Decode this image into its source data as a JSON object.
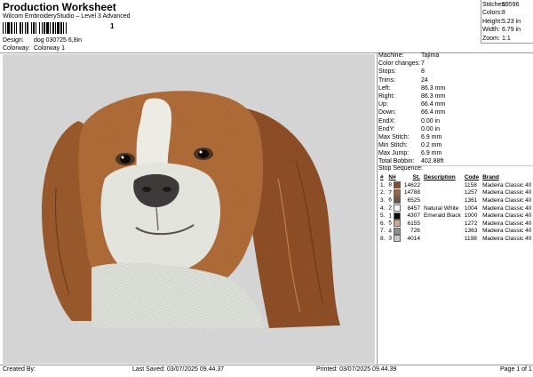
{
  "header": {
    "title": "Production Worksheet",
    "subtitle": "Wilcom EmbroideryStudio – Level 3 Advanced",
    "barcode_suffix": "1"
  },
  "design_info": [
    {
      "label": "Design:",
      "value": "dog 030725 6,8in"
    },
    {
      "label": "Colorway:",
      "value": "Colorway 1"
    }
  ],
  "stats": [
    {
      "label": "Stitches:",
      "value": "59596"
    },
    {
      "label": "Colors:",
      "value": "8"
    },
    {
      "label": "Height:",
      "value": "5.23 in"
    },
    {
      "label": "Width:",
      "value": "6.79 in"
    },
    {
      "label": "Zoom:",
      "value": "1:1"
    }
  ],
  "machine_info": [
    {
      "label": "Machine:",
      "value": "Tajima"
    },
    {
      "label": "Color changes:",
      "value": "7"
    },
    {
      "label": "Stops:",
      "value": "8"
    },
    {
      "label": "Trims:",
      "value": "24"
    },
    {
      "label": "Left:",
      "value": "86.3 mm"
    },
    {
      "label": "Right:",
      "value": "86.3 mm"
    },
    {
      "label": "Up:",
      "value": "66.4 mm"
    },
    {
      "label": "Down:",
      "value": "66.4 mm"
    },
    {
      "label": "EndX:",
      "value": "0.00 in"
    },
    {
      "label": "EndY:",
      "value": "0.00 in"
    },
    {
      "label": "Max Stitch:",
      "value": "6.9 mm"
    },
    {
      "label": "Min Stitch:",
      "value": "0.2 mm"
    },
    {
      "label": "Max Jump:",
      "value": "6.9 mm"
    },
    {
      "label": "Total Bobbin:",
      "value": "402.88ft"
    }
  ],
  "stop_sequence": {
    "title": "Stop Sequence:",
    "headers": [
      "#",
      "N#",
      "St.",
      "Description",
      "Code",
      "Brand"
    ],
    "rows": [
      {
        "num": "1.",
        "n": "8",
        "color": "#8c4a28",
        "st": "14622",
        "desc": "",
        "code": "1158",
        "brand": "Madeira Classic 40"
      },
      {
        "num": "2.",
        "n": "7",
        "color": "#a0623a",
        "st": "14788",
        "desc": "",
        "code": "1257",
        "brand": "Madeira Classic 40"
      },
      {
        "num": "3.",
        "n": "6",
        "color": "#6e5648",
        "st": "6525",
        "desc": "",
        "code": "1361",
        "brand": "Madeira Classic 40"
      },
      {
        "num": "4.",
        "n": "2",
        "color": "#f4f4f4",
        "st": "8457",
        "desc": "Natural White",
        "code": "1004",
        "brand": "Madeira Classic 40"
      },
      {
        "num": "5.",
        "n": "1",
        "color": "#0a0a0a",
        "st": "4307",
        "desc": "Emerald Black",
        "code": "1000",
        "brand": "Madeira Classic 40"
      },
      {
        "num": "6.",
        "n": "5",
        "color": "#d6a48c",
        "st": "6155",
        "desc": "",
        "code": "1272",
        "brand": "Madeira Classic 40"
      },
      {
        "num": "7.",
        "n": "4",
        "color": "#8f8f8a",
        "st": "726",
        "desc": "",
        "code": "1363",
        "brand": "Madeira Classic 40"
      },
      {
        "num": "8.",
        "n": "3",
        "color": "#c6c8c6",
        "st": "4014",
        "desc": "",
        "code": "1198",
        "brand": "Madeira Classic 40"
      }
    ]
  },
  "footer": {
    "created_by": "Created By:",
    "last_saved": "Last Saved: 03/07/2025 09.44.37",
    "printed": "Printed: 03/07/2025 09.44.39",
    "page": "Page 1 of 1"
  }
}
